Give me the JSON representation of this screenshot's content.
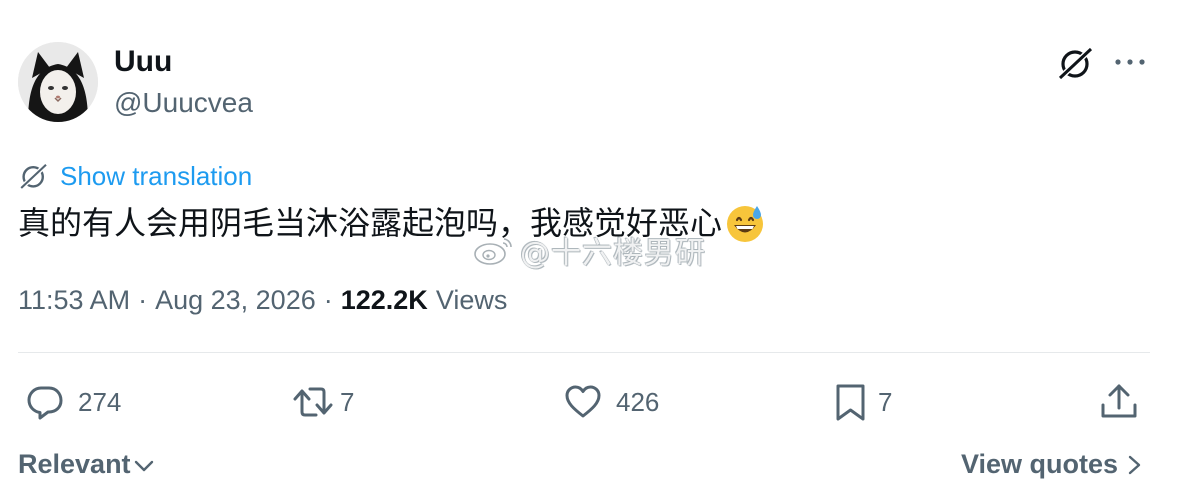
{
  "author": {
    "display_name": "Uuu",
    "handle": "@Uuucvea",
    "avatar_icon": "cat-in-black-hood-avatar"
  },
  "header_actions": {
    "grok_icon": "grok-icon",
    "more_icon": "more-dots-icon"
  },
  "translation": {
    "icon": "grok-icon",
    "label": "Show translation"
  },
  "tweet": {
    "text": "真的有人会用阴毛当沐浴露起泡吗，我感觉好恶心",
    "emoji": "grinning-face-with-sweat"
  },
  "watermark": {
    "text": "@十六楼男研",
    "icon": "weibo-logo"
  },
  "meta": {
    "time": "11:53 AM",
    "separator": "·",
    "date": "Aug 23, 2026",
    "views_count": "122.2K",
    "views_label": "Views"
  },
  "actions": {
    "reply": {
      "icon": "reply-icon",
      "count": "274"
    },
    "retweet": {
      "icon": "retweet-icon",
      "count": "7"
    },
    "like": {
      "icon": "heart-icon",
      "count": "426"
    },
    "bookmark": {
      "icon": "bookmark-icon",
      "count": "7"
    },
    "share": {
      "icon": "share-icon"
    }
  },
  "footer": {
    "sort_label": "Relevant",
    "view_quotes_label": "View quotes"
  },
  "colors": {
    "link_blue": "#1d9bf0",
    "text_primary": "#0f1419",
    "text_secondary": "#536471",
    "divider": "#e6e9eb"
  }
}
